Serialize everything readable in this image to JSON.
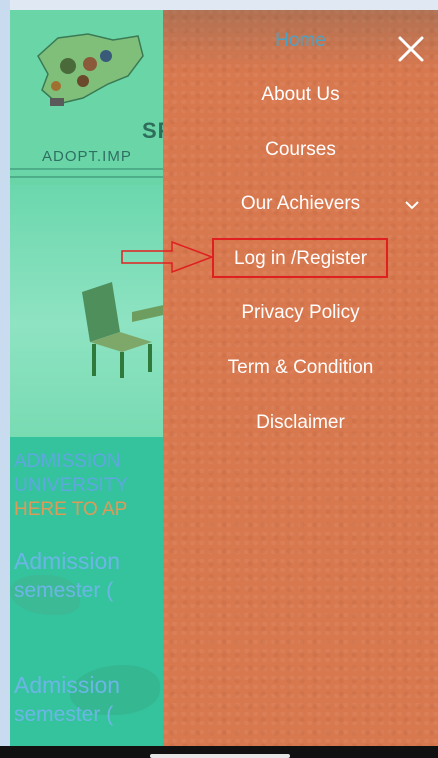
{
  "background_page": {
    "brand": "SP",
    "domain": "ADOPT.IMP",
    "notice_line1": "ADMISSION",
    "notice_line2": "UNIVERSITY",
    "notice_line3": "HERE TO AP",
    "news1_title": "Admission",
    "news1_sub": "semester (",
    "news2_title": "Admission",
    "news2_sub": "semester ("
  },
  "menu": {
    "items": [
      {
        "label": "Home"
      },
      {
        "label": "About Us"
      },
      {
        "label": "Courses"
      },
      {
        "label": "Our Achievers"
      },
      {
        "label": "Log in /Register"
      },
      {
        "label": "Privacy Policy"
      },
      {
        "label": "Term & Condition"
      },
      {
        "label": "Disclaimer"
      }
    ],
    "close_icon": "close-icon",
    "dropdown_icon": "chevron-down-icon"
  },
  "annotation": {
    "highlight_color": "#e02020",
    "pointer_icon": "arrow-right-icon"
  },
  "colors": {
    "menu_bg": "#d8784f",
    "page_bg": "#6fd9ad",
    "active_item": "#4aa3c4"
  }
}
